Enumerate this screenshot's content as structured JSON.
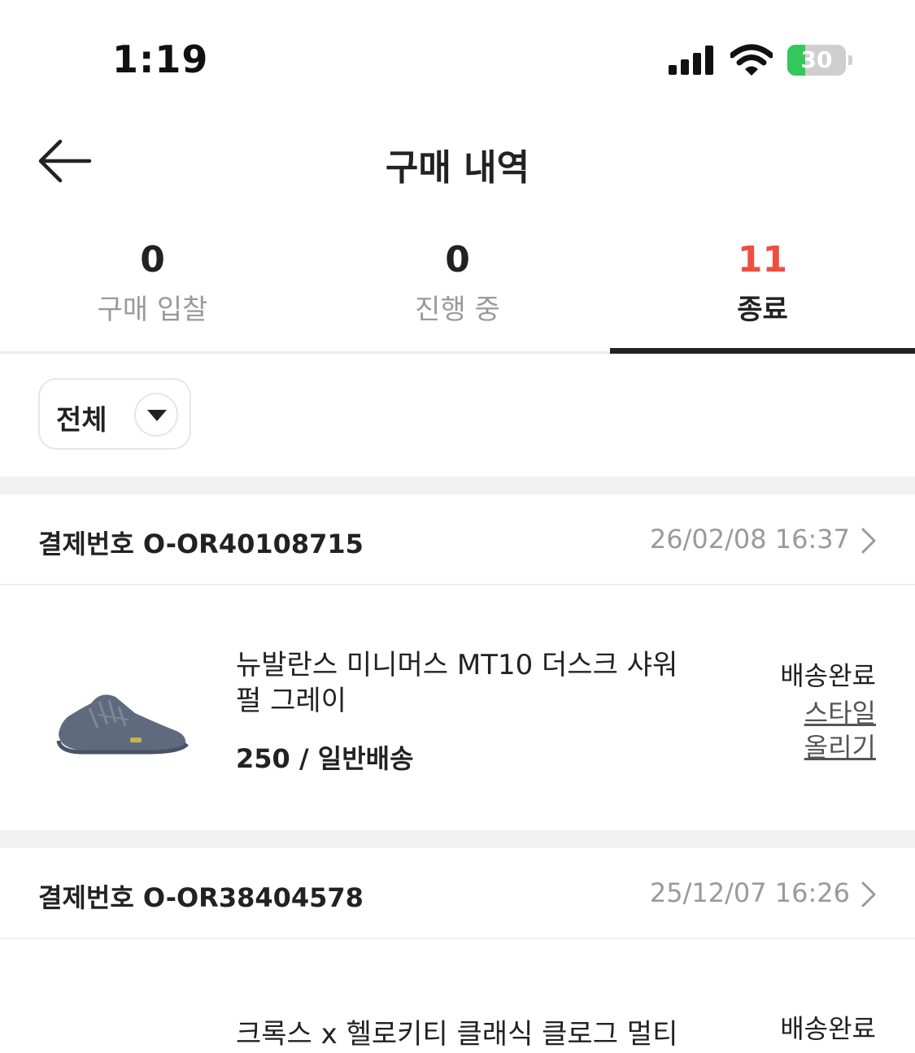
{
  "status_bar": {
    "time": "1:19",
    "battery": "30",
    "battery_level": 0.3
  },
  "header": {
    "title": "구매 내역"
  },
  "tabs": [
    {
      "count": "0",
      "label": "구매 입찰"
    },
    {
      "count": "0",
      "label": "진행 중"
    },
    {
      "count": "11",
      "label": "종료"
    }
  ],
  "filter": {
    "label": "전체"
  },
  "orders": [
    {
      "label": "결제번호 O-OR40108715",
      "date": "26/02/08 16:37",
      "product_name": "뉴발란스 미니머스 MT10 더스크 샤워 펄 그레이",
      "option": "250 / 일반배송",
      "status": "배송완료",
      "style_link": "스타일 올리기"
    },
    {
      "label": "결제번호 O-OR38404578",
      "date": "25/12/07 16:26",
      "product_name": "크록스 x 헬로키티 클래식 클로그 멀티",
      "status": "배송완료"
    }
  ],
  "colors": {
    "accent": "#ef4e3f",
    "text": "#222222",
    "muted": "#9a9a9a",
    "divider": "#f2f2f2"
  }
}
